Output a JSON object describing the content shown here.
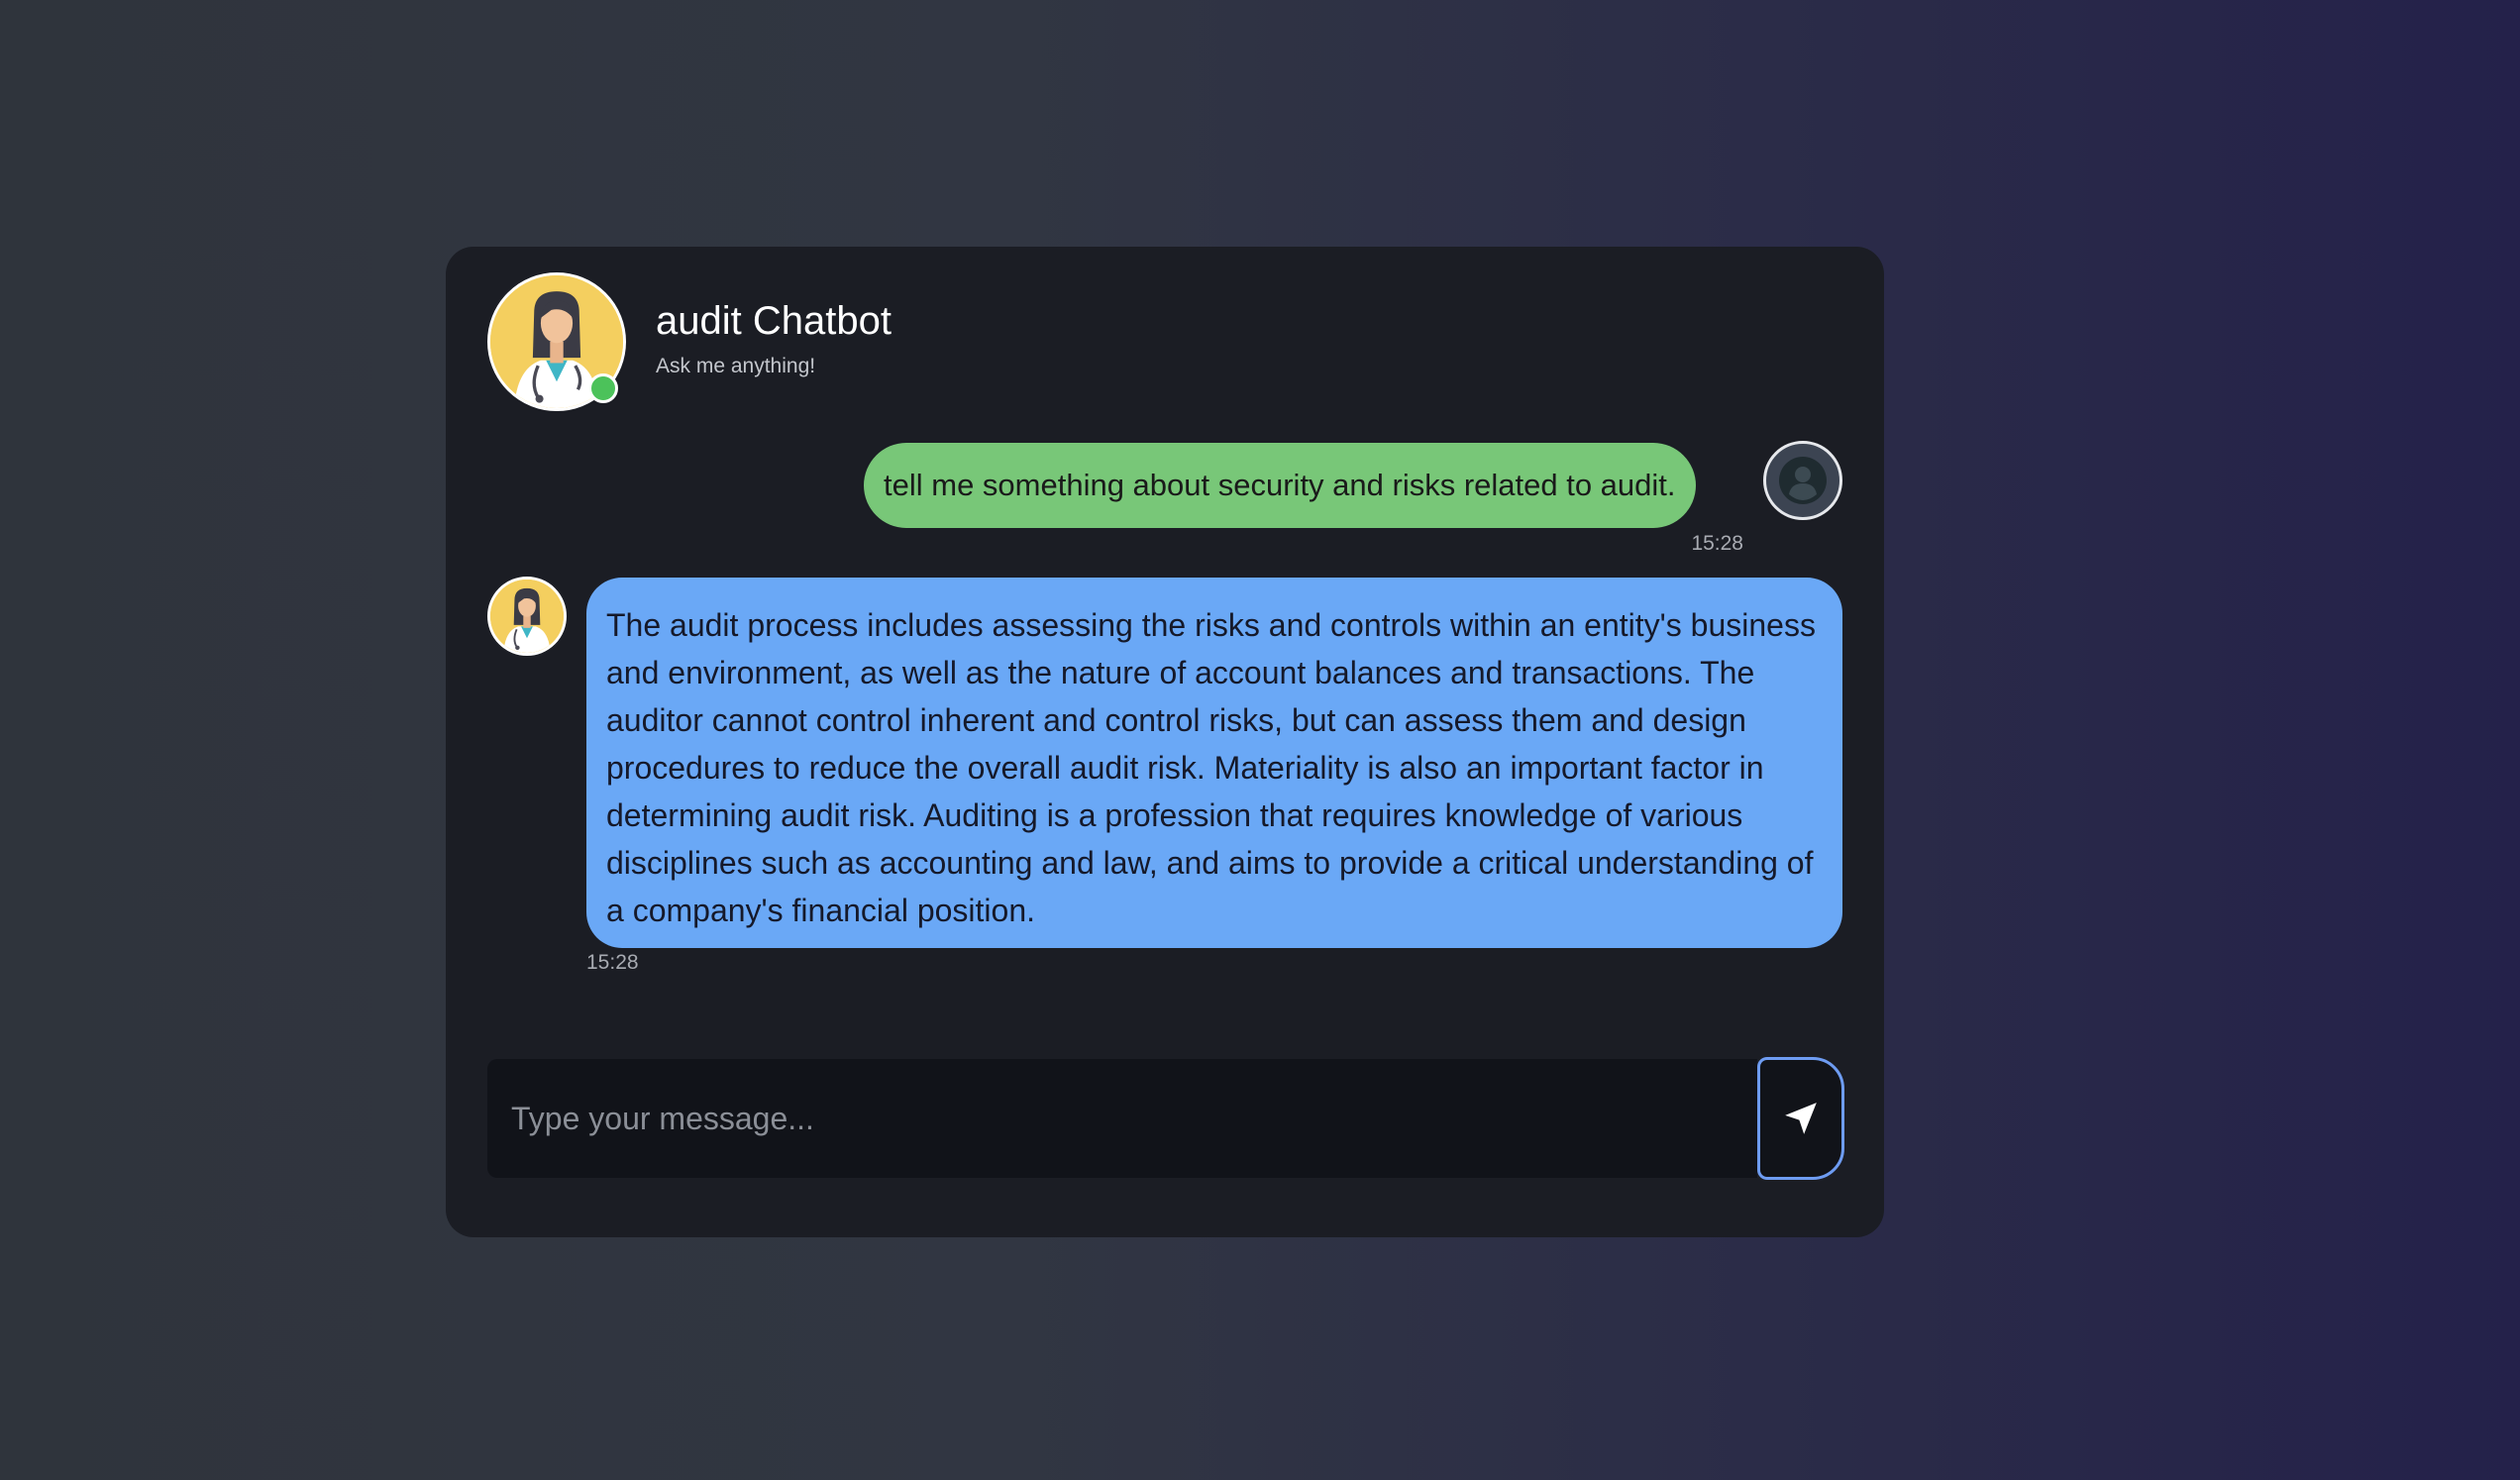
{
  "header": {
    "title": "audit Chatbot",
    "subtitle": "Ask me anything!",
    "bot_avatar_icon": "doctor-avatar-icon",
    "status": "online",
    "status_color": "#4cc25a"
  },
  "messages": [
    {
      "sender": "user",
      "text": "tell me something about security and risks related to audit.",
      "time": "15:28",
      "bubble_color": "#78c778",
      "avatar_icon": "user-circle-icon"
    },
    {
      "sender": "bot",
      "text": "The audit process includes assessing the risks and controls within an entity's business and environment, as well as the nature of account balances and transactions. The auditor cannot control inherent and control risks, but can assess them and design procedures to reduce the overall audit risk. Materiality is also an important factor in determining audit risk. Auditing is a profession that requires knowledge of various disciplines such as accounting and law, and aims to provide a critical understanding of a company's financial position.",
      "time": "15:28",
      "bubble_color": "#6aa8f6",
      "avatar_icon": "doctor-avatar-icon"
    }
  ],
  "composer": {
    "placeholder": "Type your message...",
    "value": "",
    "send_icon": "send-arrow-icon",
    "send_border_color": "#6e9cf2"
  }
}
